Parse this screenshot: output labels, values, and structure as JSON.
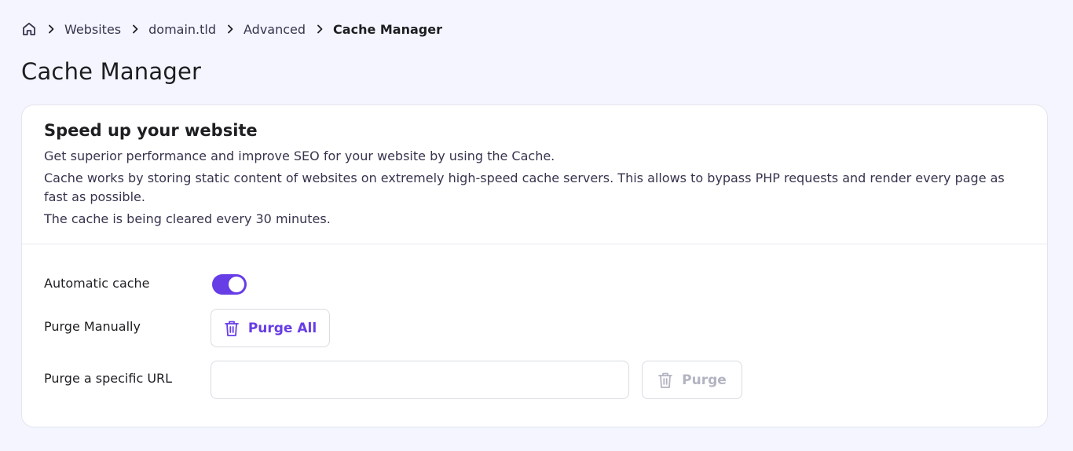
{
  "breadcrumb": {
    "home_icon": "home-icon",
    "separator_icon": "chevron-right-icon",
    "items": [
      "Websites",
      "domain.tld",
      "Advanced",
      "Cache Manager"
    ]
  },
  "page": {
    "title": "Cache Manager"
  },
  "card": {
    "title": "Speed up your website",
    "description": [
      "Get superior performance and improve SEO for your website by using the Cache.",
      "Cache works by storing static content of websites on extremely high-speed cache servers. This allows to bypass PHP requests and render every page as fast as possible.",
      "The cache is being cleared every 30 minutes."
    ]
  },
  "settings": {
    "automatic_cache": {
      "label": "Automatic cache",
      "enabled": true
    },
    "purge_manually": {
      "label": "Purge Manually",
      "button_label": "Purge All",
      "icon": "trash-icon"
    },
    "purge_url": {
      "label": "Purge a specific URL",
      "input_value": "",
      "placeholder": "",
      "button_label": "Purge",
      "icon": "trash-icon"
    }
  },
  "colors": {
    "accent": "#673de6",
    "disabled": "#b3b4c2",
    "background": "#f4f5ff"
  }
}
